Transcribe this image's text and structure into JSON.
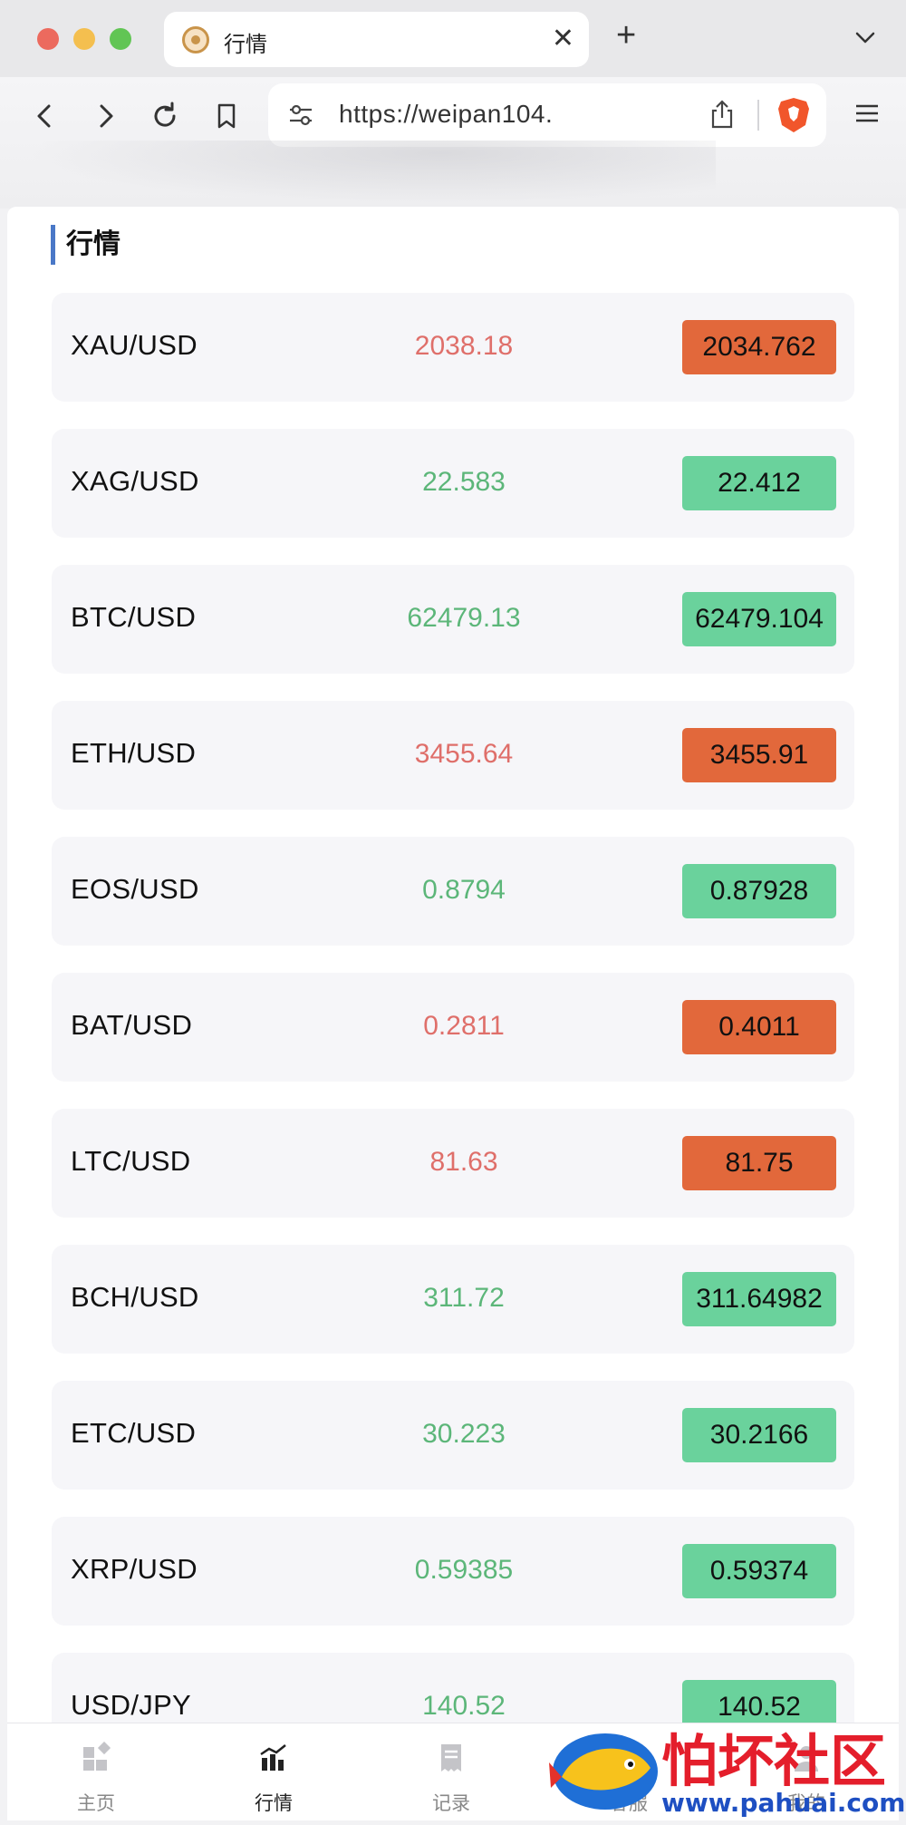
{
  "browser": {
    "tab_title": "行情",
    "url": "https://weipan104."
  },
  "page": {
    "section_title": "行情"
  },
  "quotes": [
    {
      "symbol": "XAU/USD",
      "price": "2038.18",
      "badge": "2034.762",
      "trend": "up"
    },
    {
      "symbol": "XAG/USD",
      "price": "22.583",
      "badge": "22.412",
      "trend": "down"
    },
    {
      "symbol": "BTC/USD",
      "price": "62479.13",
      "badge": "62479.104",
      "trend": "down"
    },
    {
      "symbol": "ETH/USD",
      "price": "3455.64",
      "badge": "3455.91",
      "trend": "up"
    },
    {
      "symbol": "EOS/USD",
      "price": "0.8794",
      "badge": "0.87928",
      "trend": "down"
    },
    {
      "symbol": "BAT/USD",
      "price": "0.2811",
      "badge": "0.4011",
      "trend": "up"
    },
    {
      "symbol": "LTC/USD",
      "price": "81.63",
      "badge": "81.75",
      "trend": "up"
    },
    {
      "symbol": "BCH/USD",
      "price": "311.72",
      "badge": "311.64982",
      "trend": "down"
    },
    {
      "symbol": "ETC/USD",
      "price": "30.223",
      "badge": "30.2166",
      "trend": "down"
    },
    {
      "symbol": "XRP/USD",
      "price": "0.59385",
      "badge": "0.59374",
      "trend": "down"
    },
    {
      "symbol": "USD/JPY",
      "price": "140.52",
      "badge": "140.52",
      "trend": "down"
    }
  ],
  "bottom_nav": [
    {
      "label": "主页",
      "icon": "home-grid-icon",
      "active": false
    },
    {
      "label": "行情",
      "icon": "bar-chart-icon",
      "active": true
    },
    {
      "label": "记录",
      "icon": "receipt-icon",
      "active": false
    },
    {
      "label": "客服",
      "icon": "support-icon",
      "active": false
    },
    {
      "label": "我的",
      "icon": "user-icon",
      "active": false
    }
  ],
  "watermark": {
    "text": "怕坏社区",
    "url": "www.pahuai.com"
  },
  "colors": {
    "up": "#e2683b",
    "up_text": "#df6f6a",
    "down": "#6ad29c",
    "down_text": "#5cb679",
    "accent": "#4a78c7"
  }
}
